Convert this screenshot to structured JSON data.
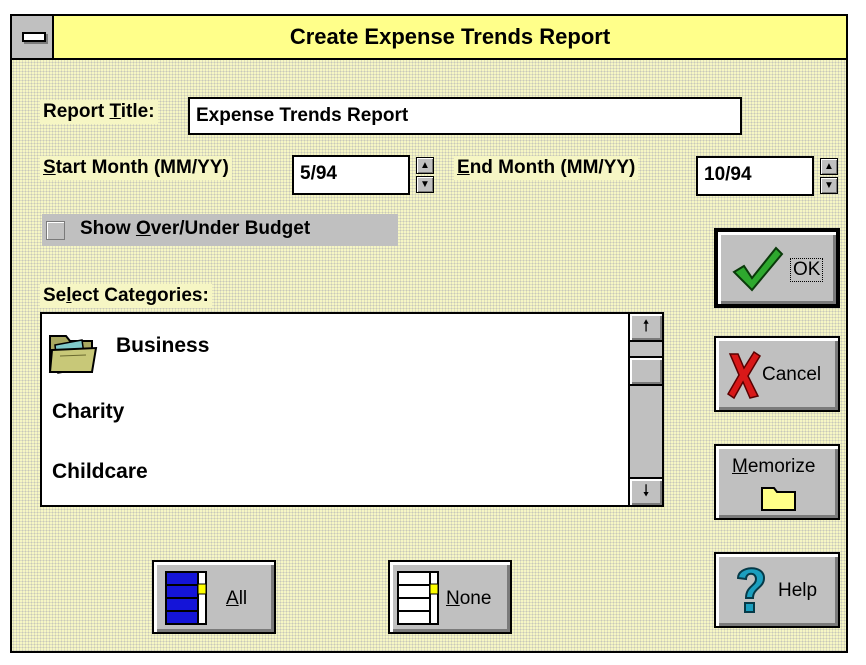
{
  "window": {
    "title": "Create Expense Trends Report"
  },
  "form": {
    "report_title_label_pre": "Report ",
    "report_title_label_u": "T",
    "report_title_label_post": "itle:",
    "report_title_value": "Expense Trends Report",
    "start_label_u": "S",
    "start_label_post": "tart Month (MM/YY)",
    "start_value": "5/94",
    "end_label_u": "E",
    "end_label_post": "nd Month (MM/YY)",
    "end_value": "10/94",
    "show_budget_pre": "Show ",
    "show_budget_u": "O",
    "show_budget_post": "ver/Under Budget",
    "show_budget_checked": false,
    "categories_label_pre": "Se",
    "categories_label_u": "l",
    "categories_label_post": "ect Categories:"
  },
  "categories": {
    "items": [
      "Business",
      "Charity",
      "Childcare"
    ]
  },
  "buttons": {
    "ok": "OK",
    "cancel": "Cancel",
    "memorize_u": "M",
    "memorize_post": "emorize",
    "help": "Help",
    "all_u": "A",
    "all_post": "ll",
    "none_u": "N",
    "none_post": "one"
  },
  "icons": {
    "ok": "checkmark-icon",
    "cancel": "red-x-icon",
    "memorize": "folder-icon",
    "help": "question-mark-icon",
    "all": "select-all-icon",
    "none": "select-none-icon",
    "business": "folder-icon"
  },
  "colors": {
    "title_bar": "#ffff8a",
    "face": "#c0c0c0",
    "background": "#f6f6c4",
    "check_green": "#2ea82e",
    "cancel_red": "#d81818",
    "help_teal": "#1b9fbf",
    "all_blue": "#1414d8"
  }
}
